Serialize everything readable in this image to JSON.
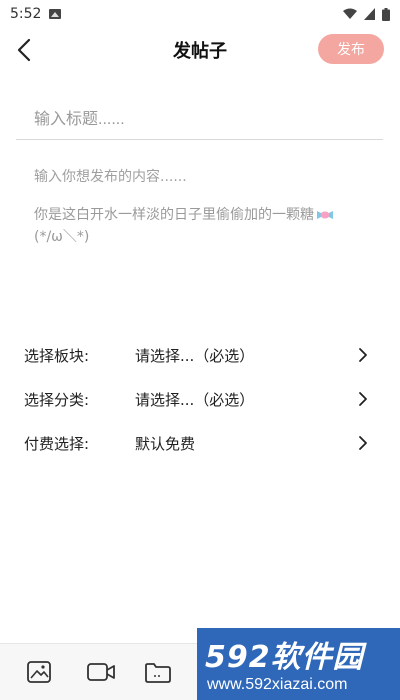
{
  "status_bar": {
    "time": "5:52"
  },
  "header": {
    "title": "发帖子",
    "publish_label": "发布"
  },
  "form": {
    "title_placeholder": "输入标题......",
    "content_placeholder": "输入你想发布的内容......",
    "hint_line1": "你是这白开水一样淡的日子里偷偷加的一颗糖",
    "hint_line2": "(*/ω＼*)"
  },
  "options": [
    {
      "label": "选择板块:",
      "value": "请选择...（必选）"
    },
    {
      "label": "选择分类:",
      "value": "请选择...（必选）"
    },
    {
      "label": "付费选择:",
      "value": "默认免费"
    }
  ],
  "watermark": {
    "logo": "592软件园",
    "url": "www.592xiazai.com"
  },
  "colors": {
    "publish_bg": "#f3a7a0",
    "watermark_bg": "#2f67b9",
    "divider": "#d9d9d9"
  }
}
